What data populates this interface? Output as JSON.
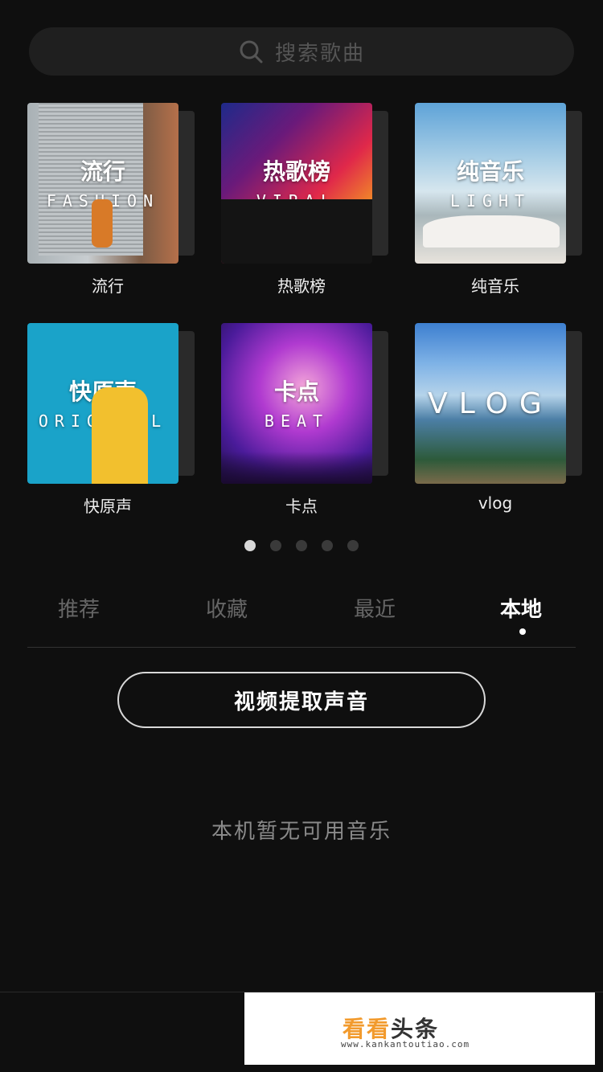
{
  "search": {
    "placeholder": "搜索歌曲"
  },
  "categories": [
    {
      "label": "流行",
      "cover_title": "流行",
      "cover_subtitle": "FASHION"
    },
    {
      "label": "热歌榜",
      "cover_title": "热歌榜",
      "cover_subtitle": "VIRAL"
    },
    {
      "label": "纯音乐",
      "cover_title": "纯音乐",
      "cover_subtitle": "LIGHT"
    },
    {
      "label": "快原声",
      "cover_title": "快原声",
      "cover_subtitle": "ORIGINAL"
    },
    {
      "label": "卡点",
      "cover_title": "卡点",
      "cover_subtitle": "BEAT"
    },
    {
      "label": "vlog",
      "cover_title": "VLOG"
    }
  ],
  "pager": {
    "count": 5,
    "active_index": 0
  },
  "tabs": [
    {
      "label": "推荐"
    },
    {
      "label": "收藏"
    },
    {
      "label": "最近"
    },
    {
      "label": "本地"
    }
  ],
  "active_tab": "本地",
  "extract_button": {
    "label": "视频提取声音"
  },
  "empty_state": {
    "text": "本机暂无可用音乐"
  },
  "watermark": {
    "logo_text_1": "看看",
    "logo_text_2": "头条",
    "url": "www.kankantoutiao.com"
  }
}
